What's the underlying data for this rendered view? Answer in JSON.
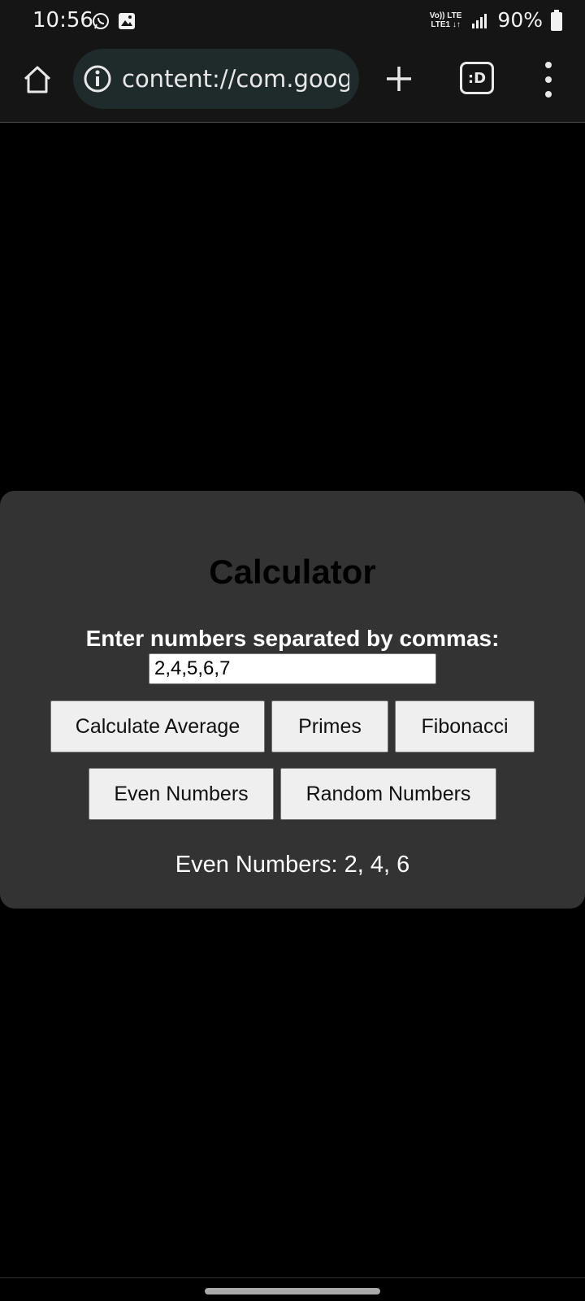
{
  "status_bar": {
    "time": "10:56",
    "network_top": "Vo)) LTE",
    "network_bottom": "LTE1 ↓↑",
    "battery": "90%"
  },
  "browser": {
    "url": "content://com.google",
    "tabs_label": ":D"
  },
  "calculator": {
    "title": "Calculator",
    "prompt": "Enter numbers separated by commas:",
    "input_value": "2,4,5,6,7",
    "buttons": {
      "average": "Calculate Average",
      "primes": "Primes",
      "fibonacci": "Fibonacci",
      "even": "Even Numbers",
      "random": "Random Numbers"
    },
    "result": "Even Numbers: 2, 4, 6"
  },
  "icons": {
    "whatsapp": "whatsapp-icon",
    "gallery": "gallery-icon",
    "signal": "signal-icon",
    "battery": "battery-icon",
    "home": "home-icon",
    "info": "info-icon",
    "plus": "plus-icon",
    "menu": "more-vert-icon"
  }
}
